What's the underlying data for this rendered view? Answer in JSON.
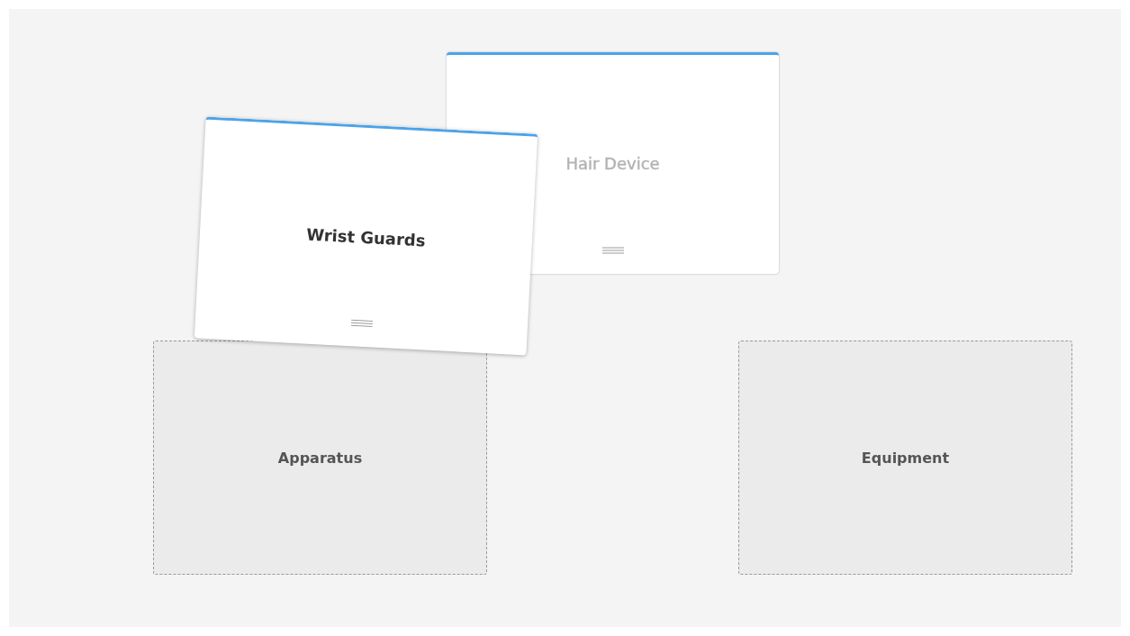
{
  "cards": [
    {
      "label": "Hair Device",
      "dimmed": true,
      "dragging": false
    },
    {
      "label": "Wrist Guards",
      "dimmed": false,
      "dragging": true
    }
  ],
  "drop_zones": [
    {
      "label": "Apparatus"
    },
    {
      "label": "Equipment"
    }
  ]
}
